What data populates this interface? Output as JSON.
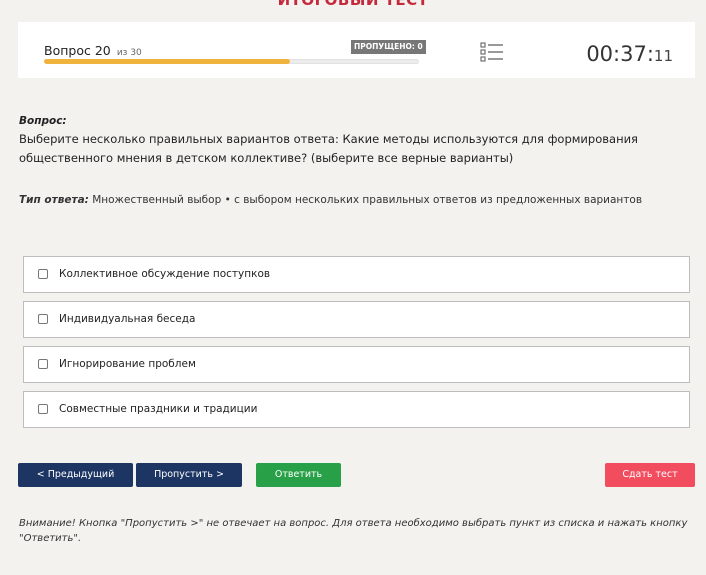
{
  "page": {
    "title": "Итоговый тест"
  },
  "status": {
    "question_label": "Вопрос 20",
    "question_of": "из 30",
    "skipped_label": "ПРОПУЩЕНО: 0",
    "progress_fraction": 0.6553,
    "timer_main": "00:37:",
    "timer_seconds": "11"
  },
  "question": {
    "heading": "Вопрос:",
    "text": "Выберите несколько правильных вариантов ответа: Какие методы используются для формирования общественного мнения в детском коллективе? (выберите все верные варианты)",
    "answer_type_label": "Тип ответа:",
    "answer_type_value": " Множественный выбор • с выбором нескольких правильных ответов из предложенных вариантов"
  },
  "options": [
    "Коллективное обсуждение поступков",
    "Индивидуальная беседа",
    "Игнорирование проблем",
    "Совместные праздники и традиции"
  ],
  "buttons": {
    "prev": "< Предыдущий",
    "skip": "Пропустить >",
    "answer": "Ответить",
    "submit": "Сдать тест"
  },
  "notice": "Внимание! Кнопка \"Пропустить >\" не отвечает на вопрос. Для ответа необходимо выбрать пункт из списка и нажать кнопку \"Ответить\".",
  "icons": {
    "question_list": "list-icon"
  },
  "colors": {
    "title": "#c42a3c",
    "progress": "#f0b33d",
    "nav_button": "#1c3563",
    "answer_button": "#27a047",
    "submit_button": "#f24d5f",
    "badge": "#777777"
  }
}
